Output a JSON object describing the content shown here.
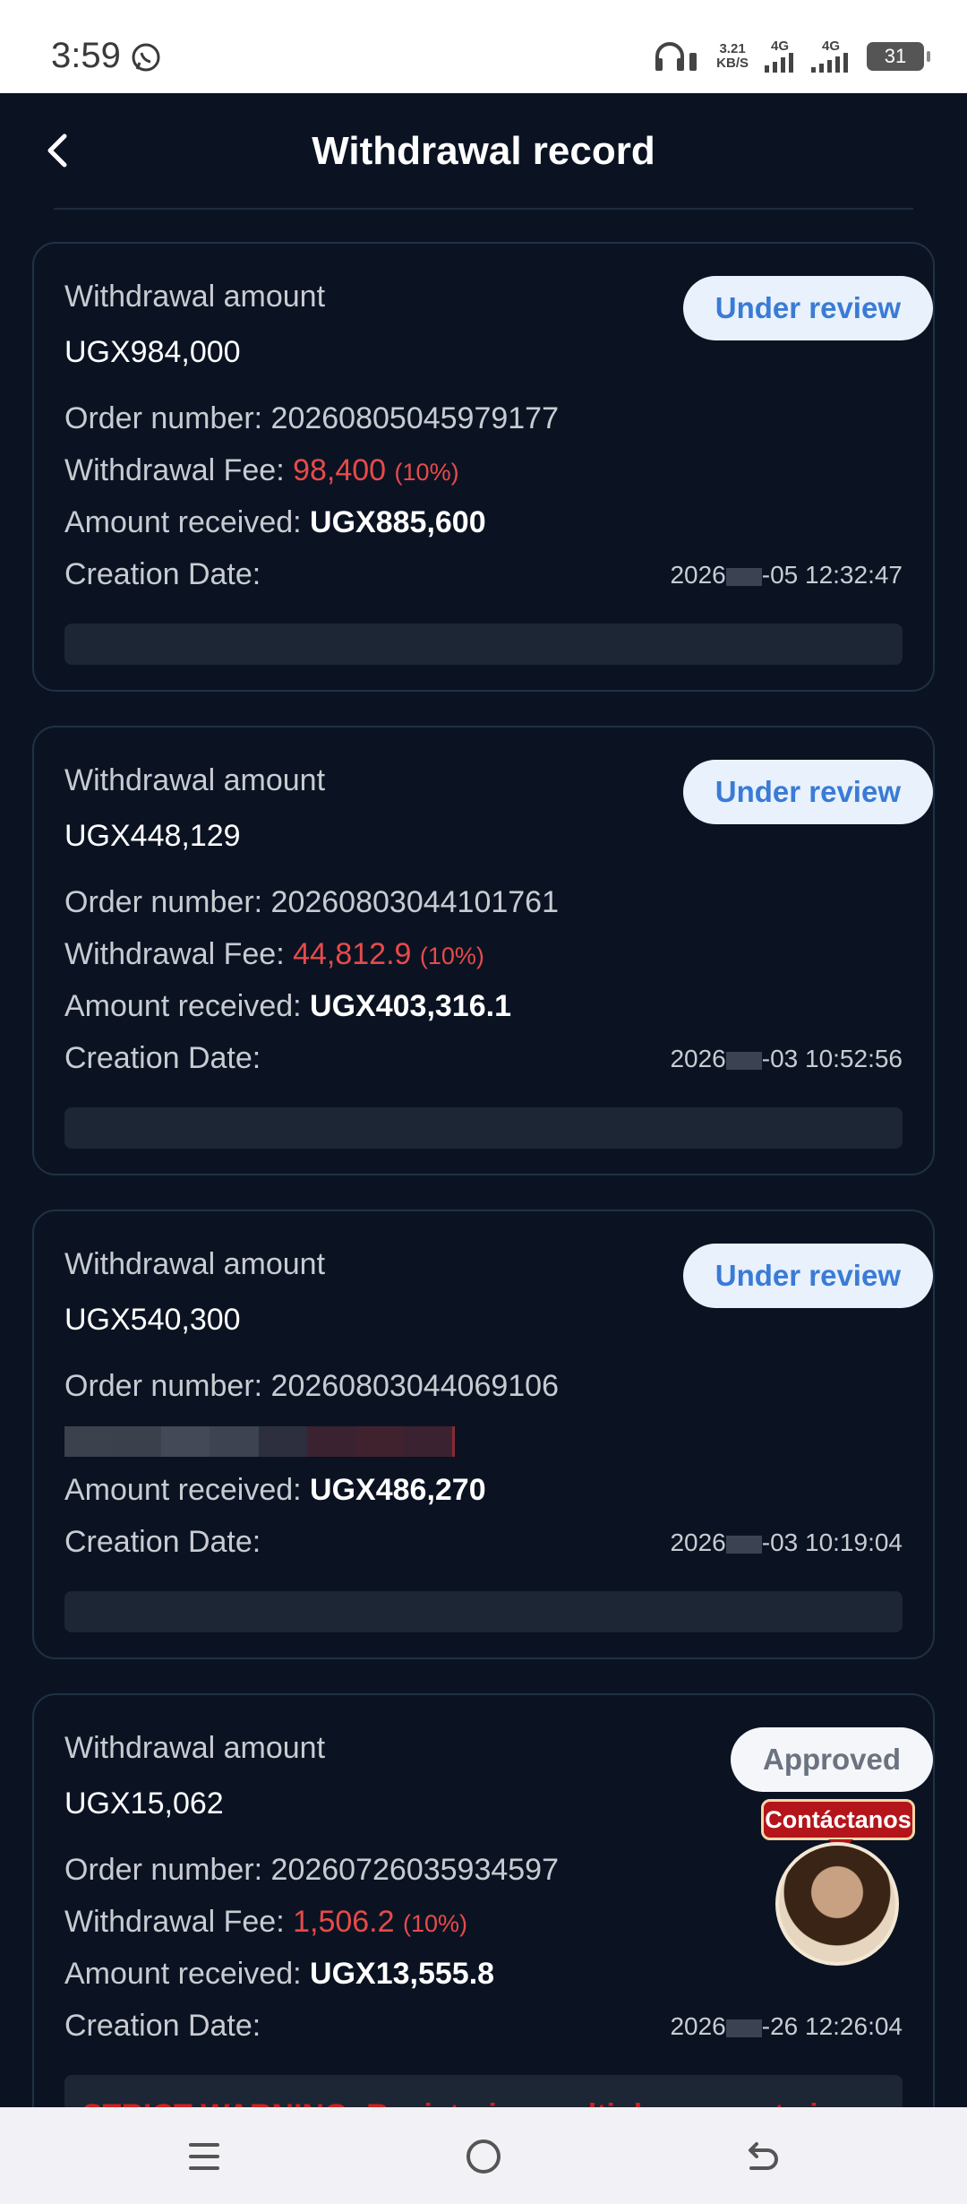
{
  "status_bar": {
    "time": "3:59",
    "net_speed_value": "3.21",
    "net_speed_unit": "KB/S",
    "signal1_label": "4G",
    "signal2_label": "4G",
    "battery": "31"
  },
  "header": {
    "title": "Withdrawal record"
  },
  "labels": {
    "withdrawal_amount": "Withdrawal amount",
    "order_number": "Order number:",
    "withdrawal_fee": "Withdrawal Fee:",
    "amount_received": "Amount received:",
    "creation_date": "Creation Date:"
  },
  "records": [
    {
      "status": "Under review",
      "amount": "UGX984,000",
      "order_number": "20260805045979177",
      "fee": "98,400",
      "fee_pct": "(10%)",
      "received": "UGX885,600",
      "date_prefix": "2026",
      "date_suffix": "-05 12:32:47"
    },
    {
      "status": "Under review",
      "amount": "UGX448,129",
      "order_number": "20260803044101761",
      "fee": "44,812.9",
      "fee_pct": "(10%)",
      "received": "UGX403,316.1",
      "date_prefix": "2026",
      "date_suffix": "-03 10:52:56"
    },
    {
      "status": "Under review",
      "amount": "UGX540,300",
      "order_number": "20260803044069106",
      "received": "UGX486,270",
      "date_prefix": "2026",
      "date_suffix": "-03 10:19:04"
    },
    {
      "status": "Approved",
      "amount": "UGX15,062",
      "order_number": "20260726035934597",
      "fee": "1,506.2",
      "fee_pct": "(10%)",
      "received": "UGX13,555.8",
      "date_prefix": "2026",
      "date_suffix": "-26 12:26:04"
    }
  ],
  "warning": "STRICT WARNING: Registering multiple accounts is",
  "contact": {
    "label": "Contáctanos"
  },
  "colors": {
    "background": "#0b1322",
    "accent_blue": "#3a7bd5",
    "fee_red": "#e84a4a",
    "contact_red": "#b3151b"
  }
}
